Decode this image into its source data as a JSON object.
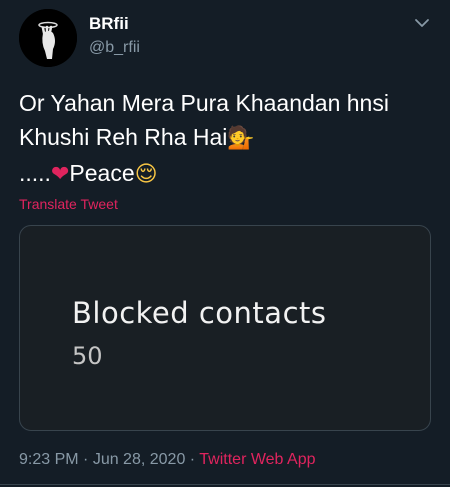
{
  "author": {
    "name": "BRfii",
    "handle": "@b_rfii"
  },
  "tweet": {
    "line1": "Or Yahan Mera Pura Khaandan hnsi",
    "line2": "Khushi Reh Rha Hai",
    "line2_emoji": "💁",
    "line3_dots": ".....",
    "line3_heart": "❤",
    "line3_word": "Peace",
    "line3_emoji": "😌"
  },
  "translate_label": "Translate Tweet",
  "media": {
    "title": "Blocked contacts",
    "count": "50"
  },
  "meta": {
    "time": "9:23 PM",
    "separator1": " · ",
    "date": "Jun 28, 2020",
    "separator2": " · ",
    "app": "Twitter Web App"
  },
  "colors": {
    "background": "#141d26",
    "secondary_text": "#8899a6",
    "accent_pink": "#e0245e",
    "border": "#38444d"
  },
  "icons": {
    "caret": "chevron-down-icon",
    "avatar": "avatar"
  }
}
